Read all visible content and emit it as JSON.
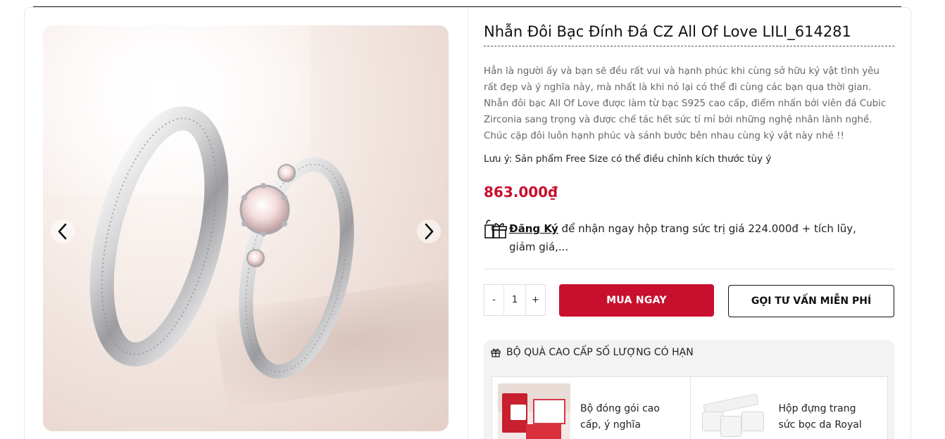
{
  "product": {
    "title": "Nhẫn Đôi Bạc Đính Đá CZ All Of Love LILI_614281",
    "description": "Hẳn là người ấy và bạn sẽ đều rất vui và hạnh phúc khi cùng sở hữu kỷ vật tình yêu rất đẹp và ý nghĩa này, mà nhất là khi nó lại có thể đi cùng các bạn qua thời gian. Nhẫn đôi bạc All Of Love được làm từ bạc S925 cao cấp, điểm nhấn bởi viên đá Cubic Zirconia sang trọng và được chế tác hết sức tỉ mỉ bởi những nghệ nhân lành nghề. Chúc cặp đôi luôn hạnh phúc và sánh bước bên nhau cùng kỷ vật này nhé !!",
    "note": "Lưu ý: Sản phẩm Free Size có thể điều chỉnh kích thước tùy ý",
    "price": "863.000₫",
    "accent_color": "#c8102e"
  },
  "promo": {
    "icon": "gift-icon",
    "register_label": "Đăng Ký",
    "text": " để nhận ngay hộp trang sức trị giá 224.000đ + tích lũy, giảm giá,..."
  },
  "quantity": {
    "minus": "-",
    "value": "1",
    "plus": "+"
  },
  "actions": {
    "buy_label": "MUA NGAY",
    "consult_label": "GỌI TƯ VẤN MIỄN PHÍ"
  },
  "gift_box": {
    "heading": "BỘ QUÀ CAO CẤP SỐ LƯỢNG CÓ HẠN",
    "items": [
      {
        "label": "Bộ đóng gói cao cấp, ý nghĩa"
      },
      {
        "label": "Hộp đựng trang sức bọc da Royal"
      }
    ]
  },
  "gallery": {
    "prev_icon": "chevron-left-icon",
    "next_icon": "chevron-right-icon"
  }
}
